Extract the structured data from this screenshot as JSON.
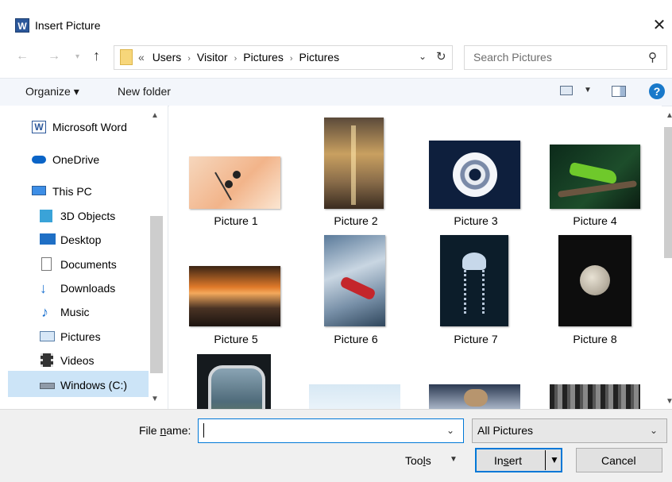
{
  "window": {
    "title": "Insert Picture",
    "close_glyph": "✕",
    "app_icon_letter": "W"
  },
  "address": {
    "crumbs": [
      "«",
      "Users",
      "Visitor",
      "Pictures",
      "Pictures"
    ],
    "separator": "›"
  },
  "search": {
    "placeholder": "Search Pictures"
  },
  "toolbar": {
    "organize_label": "Organize ▾",
    "new_folder_label": "New folder",
    "help_glyph": "?"
  },
  "nav": {
    "items": [
      {
        "label": "Microsoft Word",
        "icon": "word-icon"
      },
      {
        "label": "OneDrive",
        "icon": "cloud-icon"
      },
      {
        "label": "This PC",
        "icon": "computer-icon"
      },
      {
        "label": "3D Objects",
        "icon": "cube-icon"
      },
      {
        "label": "Desktop",
        "icon": "desktop-icon"
      },
      {
        "label": "Documents",
        "icon": "document-icon"
      },
      {
        "label": "Downloads",
        "icon": "download-arrow-icon"
      },
      {
        "label": "Music",
        "icon": "music-note-icon"
      },
      {
        "label": "Pictures",
        "icon": "pictures-icon"
      },
      {
        "label": "Videos",
        "icon": "film-icon"
      },
      {
        "label": "Windows (C:)",
        "icon": "drive-icon"
      }
    ],
    "selected": "Windows (C:)"
  },
  "files": [
    {
      "label": "Picture 1"
    },
    {
      "label": "Picture 2"
    },
    {
      "label": "Picture 3"
    },
    {
      "label": "Picture 4"
    },
    {
      "label": "Picture 5"
    },
    {
      "label": "Picture 6"
    },
    {
      "label": "Picture 7"
    },
    {
      "label": "Picture 8"
    }
  ],
  "bottom": {
    "file_name_label_pre": "File ",
    "file_name_label_u": "n",
    "file_name_label_post": "ame:",
    "file_name_value": "",
    "file_type_value": "All Pictures",
    "tools_pre": "Too",
    "tools_u": "l",
    "tools_post": "s",
    "insert_pre": "In",
    "insert_u": "s",
    "insert_post": "ert",
    "cancel_label": "Cancel"
  }
}
